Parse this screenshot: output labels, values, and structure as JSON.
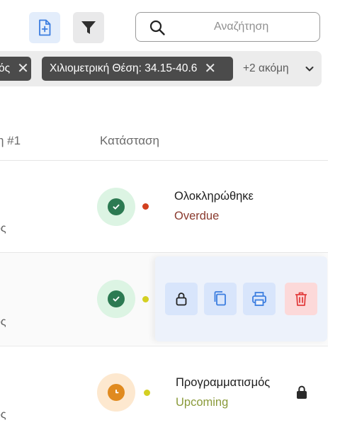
{
  "toolbar": {
    "new_icon": "file-plus-icon",
    "filter_icon": "filter-icon",
    "search_placeholder": "Αναζήτηση",
    "search_icon": "search-icon"
  },
  "filters": {
    "chip1_label": "ός",
    "chip2_label": "Χιλιομετρική Θέση: 34.15-40.6",
    "more_label": "+2 ακόμη"
  },
  "table": {
    "col1_header": "η #1",
    "col2_header": "Κατάσταση",
    "rows": [
      {
        "sub": "ος",
        "status_title": "Ολοκληρώθηκε",
        "status_sub": "Overdue",
        "status_sub_color": "#8a3a2e",
        "dot_color": "#d2401f",
        "icon": "check-icon"
      },
      {
        "sub": "ος",
        "status_title": "",
        "status_sub": "",
        "dot_color": "#d4d022",
        "icon": "check-icon",
        "actions": [
          "lock-icon",
          "copy-icon",
          "print-icon",
          "trash-icon"
        ]
      },
      {
        "sub": "ος",
        "status_title": "Προγραμματισμός",
        "status_sub": "Upcoming",
        "status_sub_color": "#8a9a3a",
        "dot_color": "#d4d022",
        "icon": "clock-icon",
        "trailing_icon": "lock-icon"
      }
    ]
  },
  "colors": {
    "accent_blue": "#3b7de0",
    "success_green": "#2c7a52",
    "warning_orange": "#e08a1f",
    "danger_red": "#e23d3d"
  }
}
